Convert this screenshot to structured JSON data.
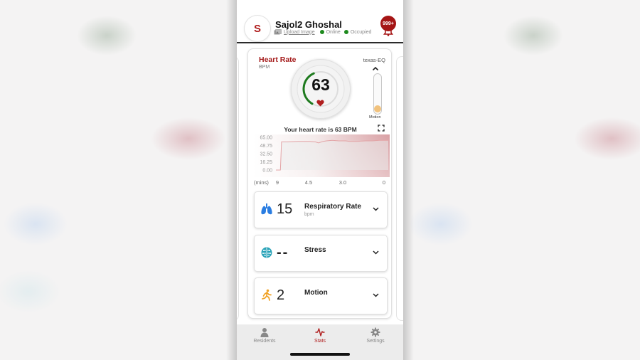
{
  "header": {
    "avatar_initial": "S",
    "user_name": "Sajol2 Ghoshal",
    "upload_label": "Upload Image",
    "statuses": [
      {
        "label": "Online",
        "color": "#1e8a1e"
      },
      {
        "label": "Occupied",
        "color": "#1e8a1e"
      }
    ],
    "notification_badge": "999+",
    "accent_color": "#a51515"
  },
  "heart_rate_card": {
    "title": "Heart Rate",
    "unit": "BPM",
    "device": "texas-EQ",
    "value": "63",
    "gauge_fraction": 0.35,
    "motion_label": "Motion",
    "motion_level": 0.0,
    "summary": "Your heart rate is 63 BPM"
  },
  "chart_data": {
    "type": "area",
    "title": "",
    "xlabel": "(mins)",
    "ylabel": "",
    "y_ticks": [
      "65.00",
      "48.75",
      "32.50",
      "16.25",
      "0.00"
    ],
    "x_ticks": [
      "9",
      "4.5",
      "3.0",
      "0"
    ],
    "ylim": [
      0,
      65
    ],
    "xlim": [
      0,
      1
    ],
    "x": [
      0.0,
      0.04,
      0.05,
      0.1,
      0.2,
      0.3,
      0.35,
      0.38,
      0.42,
      0.45,
      0.5,
      0.56,
      0.62,
      0.66,
      0.72,
      0.8,
      0.86,
      0.92,
      1.0
    ],
    "values": [
      0,
      0,
      56,
      56,
      57,
      57,
      56,
      54,
      57,
      58,
      59,
      58,
      58,
      57,
      57,
      58,
      58,
      59,
      59
    ],
    "line_color": "#e4a8a8",
    "fill_gradient": [
      "#f2f2f2",
      "#d9a0a4"
    ],
    "grid": false
  },
  "metrics": [
    {
      "icon": "lungs-icon",
      "value": "15",
      "name": "Respiratory Rate",
      "unit": "bpm",
      "color": "#2a7de1"
    },
    {
      "icon": "brain-icon",
      "value": "--",
      "name": "Stress",
      "unit": "",
      "color": "#2aa3b8"
    },
    {
      "icon": "running-icon",
      "value": "2",
      "name": "Motion",
      "unit": "",
      "color": "#f0a020"
    }
  ],
  "tabs": [
    {
      "label": "Residents",
      "icon": "person-icon",
      "active": false
    },
    {
      "label": "Stats",
      "icon": "pulse-icon",
      "active": true
    },
    {
      "label": "Settings",
      "icon": "gear-icon",
      "active": false
    }
  ]
}
